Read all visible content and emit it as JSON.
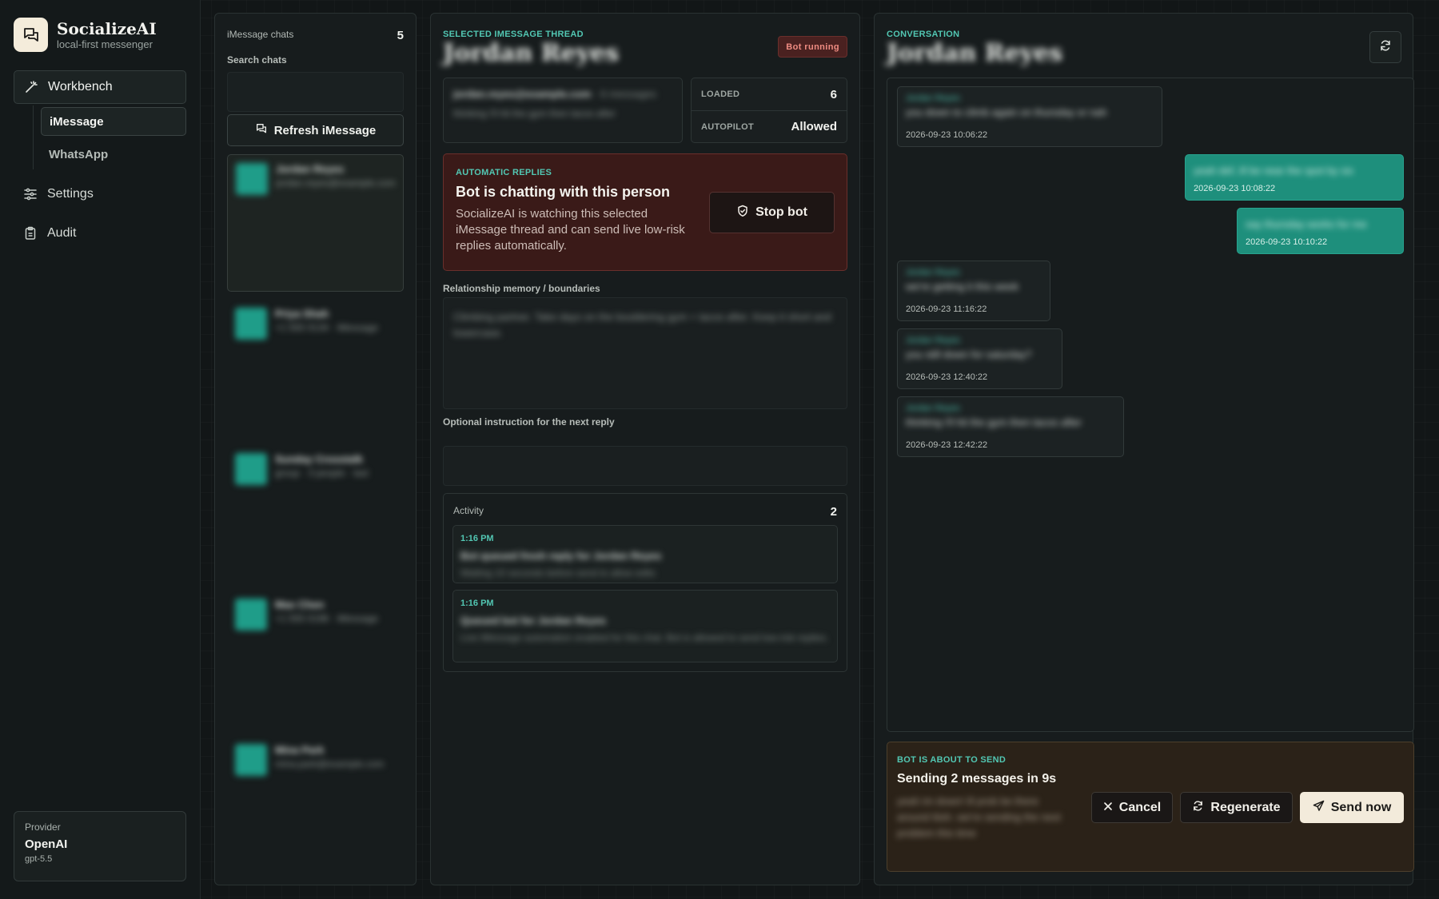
{
  "brand": {
    "name": "SocializeAI",
    "tagline": "local-first messenger"
  },
  "nav": {
    "workbench": "Workbench",
    "sub": [
      "iMessage",
      "WhatsApp"
    ],
    "settings": "Settings",
    "audit": "Audit"
  },
  "provider": {
    "label": "Provider",
    "name": "OpenAI",
    "model": "gpt-5.5"
  },
  "chats": {
    "title": "iMessage chats",
    "count": "5",
    "search_label": "Search chats",
    "search_placeholder": "",
    "refresh_label": "Refresh iMessage",
    "items": [
      {
        "name": "Jordan Reyes",
        "sub": "jordan.reyes@example.com"
      },
      {
        "name": "Priya Shah",
        "sub": "+1 555 0134 · iMessage"
      },
      {
        "name": "Sunday Crosstalk",
        "sub": "group · 3 people · last"
      },
      {
        "name": "Max Chen",
        "sub": "+1 555 0198 · iMessage"
      },
      {
        "name": "Mina Park",
        "sub": "mina.park@example.com"
      }
    ]
  },
  "thread": {
    "eyebrow": "Selected iMessage thread",
    "title": "Jordan Reyes",
    "status_badge": "Bot running",
    "contact_handle": "jordan.reyes@example.com",
    "contact_handle_extra": "· 6 messages",
    "contact_preview": "thinking i'll hit the gym then tacos after",
    "stats": {
      "loaded_label": "Loaded",
      "loaded_value": "6",
      "autopilot_label": "Autopilot",
      "autopilot_value": "Allowed"
    },
    "auto": {
      "eyebrow": "Automatic replies",
      "title": "Bot is chatting with this person",
      "desc": "SocializeAI is watching this selected iMessage thread and can send live low-risk replies automatically.",
      "stop_label": "Stop bot"
    },
    "memory_label": "Relationship memory / boundaries",
    "memory_text": "Climbing partner. Take days on the bouldering gym + tacos after. Keep it short and lowercase.",
    "instruction_label": "Optional instruction for the next reply",
    "instruction_placeholder": "",
    "activity": {
      "title": "Activity",
      "count": "2",
      "items": [
        {
          "time": "1:16 PM",
          "title": "Bot queued fresh reply for Jordan Reyes",
          "detail": "Waiting 10 seconds before send to allow edits"
        },
        {
          "time": "1:16 PM",
          "title": "Queued bot for Jordan Reyes",
          "detail": "Live iMessage automation enabled for this chat. Bot is allowed to send low-risk replies."
        }
      ]
    }
  },
  "conversation": {
    "eyebrow": "Conversation",
    "title": "Jordan Reyes",
    "messages": [
      {
        "dir": "in",
        "who": "Jordan Reyes",
        "body": "you down to climb again on thursday or nah",
        "ts": "2026-09-23 10:06:22"
      },
      {
        "dir": "out",
        "who": "",
        "body": "yeah def, ill be near the spot by six",
        "ts": "2026-09-23 10:08:22"
      },
      {
        "dir": "out",
        "who": "",
        "body": "say thursday works for me",
        "ts": "2026-09-23 10:10:22"
      },
      {
        "dir": "in",
        "who": "Jordan Reyes",
        "body": "we're getting it this week",
        "ts": "2026-09-23 11:16:22"
      },
      {
        "dir": "in",
        "who": "Jordan Reyes",
        "body": "you still down for saturday?",
        "ts": "2026-09-23 12:40:22"
      },
      {
        "dir": "in",
        "who": "Jordan Reyes",
        "body": "thinking i'll hit the gym then tacos after",
        "ts": "2026-09-23 12:42:22"
      }
    ],
    "send": {
      "eyebrow": "Bot is about to send",
      "title": "Sending 2 messages in 9s",
      "preview": "yeah im down! ill prob be there around 6ish. we're sending the next problem this time",
      "cancel_label": "Cancel",
      "regenerate_label": "Regenerate",
      "send_label": "Send now"
    }
  },
  "colors": {
    "accent": "#52c7b3",
    "bubble_out": "#1e8f7c",
    "danger_bg": "#3a1a18",
    "warn_bg": "#2b2218"
  }
}
